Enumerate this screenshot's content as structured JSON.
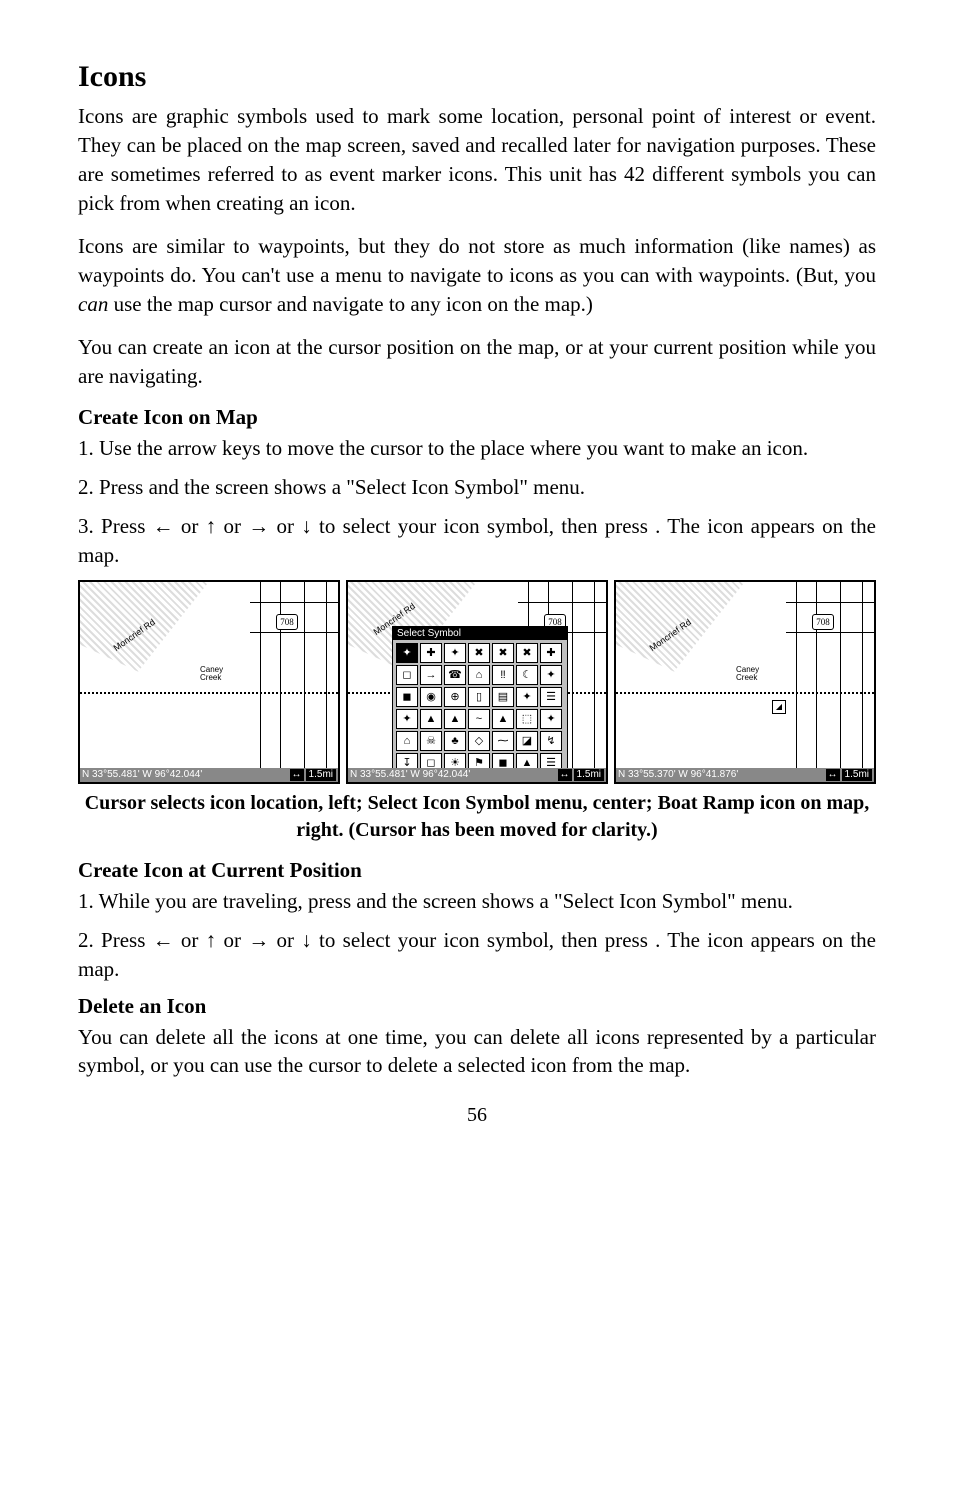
{
  "title": "Icons",
  "p1": "Icons are graphic symbols used to mark some location, personal point of interest or event. They can be placed on the map screen, saved and recalled later for navigation purposes. These are sometimes referred to as event marker icons. This unit has 42 different symbols you can pick from when creating an icon.",
  "p2a": "Icons are similar to waypoints, but they do not store as much information (like names) as waypoints do. You can't use a menu to navigate to icons as you can with waypoints. (But, you ",
  "p2em": "can",
  "p2b": " use the map cursor and navigate to any icon on the map.)",
  "p3": "You can create an icon at the cursor position on the map, or at your current position while you are navigating.",
  "sub1": "Create Icon on Map",
  "s1n1": "1. Use the arrow keys to move the cursor to the place where you want to make an icon.",
  "s1n2": "2. Press         and the screen shows a \"Select Icon Symbol\" menu.",
  "s1n3": "3. Press ← or ↑ or → or ↓ to select your icon symbol, then press        . The icon appears on the map.",
  "caption": "Cursor selects icon location, left; Select Icon Symbol menu, center; Boat Ramp icon on map, right. (Cursor has been moved for clarity.)",
  "sub2": "Create Icon at Current Position",
  "s2n1": "1. While you are traveling, press         and the screen shows a \"Select Icon Symbol\" menu.",
  "s2n2": "2. Press ← or ↑ or → or ↓ to select your icon symbol, then press        . The icon appears on the map.",
  "sub3": "Delete an Icon",
  "p4": "You can delete all the icons at one time, you can delete all icons represented by a particular symbol, or you can use the cursor to delete a selected icon from the map.",
  "pagenum": "56",
  "map": {
    "shield": "708",
    "creek": "Caney Creek",
    "road": "Moncrief Rd",
    "popup_title": "Select Symbol",
    "status_left_a": "N   33°55.481'   W   96°42.044'",
    "status_left_c": "N   33°55.370'   W   96°41.876'",
    "scale": "1.5mi",
    "symbols": [
      "✦",
      "✚",
      "✦",
      "✖",
      "✖",
      "✖",
      "✚",
      "◻",
      "→",
      "☎",
      "⌂",
      "‼",
      "☾",
      "✦",
      "◼",
      "◉",
      "⊕",
      "▯",
      "▤",
      "✦",
      "☰",
      "✦",
      "▲",
      "▲",
      "~",
      "▲",
      "⬚",
      "✦",
      "⌂",
      "☠",
      "♣",
      "◇",
      "⁓",
      "◪",
      "↯",
      "↧",
      "◻",
      "☀",
      "⚑",
      "◼",
      "▲",
      "☰"
    ]
  }
}
